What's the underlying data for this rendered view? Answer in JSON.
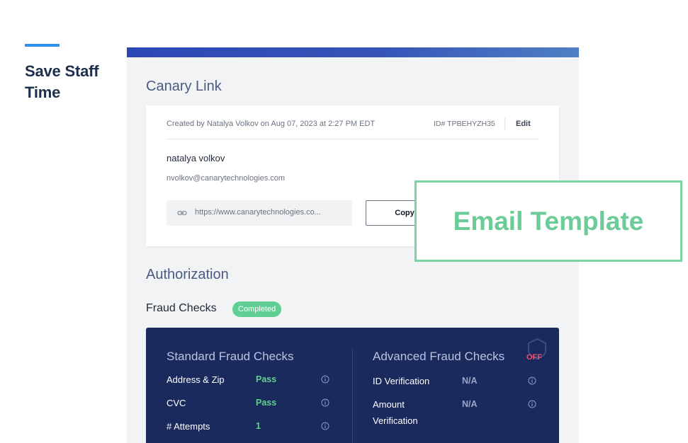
{
  "caption": {
    "headline_line1": "Save Staff",
    "headline_line2": "Time",
    "accent_color": "#2f8df0"
  },
  "canary_link": {
    "title": "Canary Link",
    "created_text": "Created by Natalya Volkov on Aug 07, 2023 at 2:27 PM EDT",
    "id_text": "ID# TPBEHYZH35",
    "edit_label": "Edit",
    "name": "natalya volkov",
    "email": "nvolkov@canarytechnologies.com",
    "url_text": "https://www.canarytechnologies.co...",
    "copy_label": "Copy"
  },
  "authorization": {
    "title": "Authorization",
    "fraud_checks_label": "Fraud Checks",
    "status_badge": "Completed",
    "standard": {
      "title": "Standard Fraud Checks",
      "rows": [
        {
          "label": "Address & Zip",
          "value": "Pass"
        },
        {
          "label": "CVC",
          "value": "Pass"
        },
        {
          "label": "# Attempts",
          "value": "1"
        }
      ]
    },
    "advanced": {
      "title": "Advanced Fraud Checks",
      "toggle": "OFF",
      "rows": [
        {
          "label": "ID Verification",
          "value": "N/A"
        },
        {
          "label": "Amount Verification",
          "label_line1": "Amount",
          "label_line2": "Verification",
          "value": "N/A"
        }
      ]
    }
  },
  "overlay": {
    "label": "Email Template"
  },
  "colors": {
    "navy": "#1a2a5c",
    "pass_green": "#62d08e",
    "badge_green": "#5fcf94",
    "off_red": "#f0506e",
    "overlay_green": "#6ccc97"
  },
  "icons": [
    "link-icon",
    "info-icon",
    "shield-icon"
  ]
}
